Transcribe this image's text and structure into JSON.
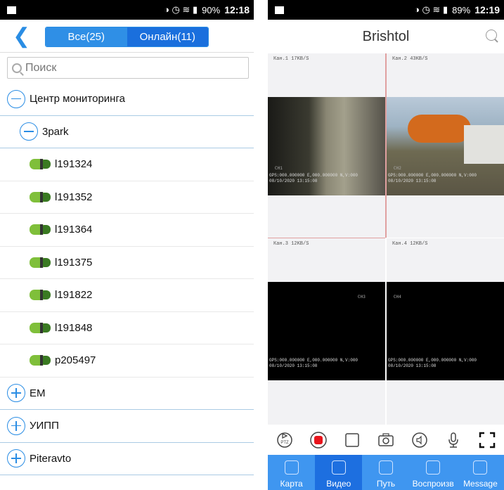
{
  "left": {
    "status": {
      "battery": "90%",
      "time": "12:18"
    },
    "seg_all": "Все(25)",
    "seg_online": "Онлайн(11)",
    "search_placeholder": "Поиск",
    "tree": [
      {
        "type": "group",
        "icon": "minus",
        "label": "Центр мониторинга",
        "indent": 0
      },
      {
        "type": "group",
        "icon": "minus",
        "label": "3park",
        "indent": 1
      },
      {
        "type": "vehicle",
        "label": "l191324"
      },
      {
        "type": "vehicle",
        "label": "l191352"
      },
      {
        "type": "vehicle",
        "label": "l191364"
      },
      {
        "type": "vehicle",
        "label": "l191375"
      },
      {
        "type": "vehicle",
        "label": "l191822"
      },
      {
        "type": "vehicle",
        "label": "l191848"
      },
      {
        "type": "vehicle",
        "label": "p205497"
      },
      {
        "type": "group",
        "icon": "plus",
        "label": "EM",
        "indent": 0
      },
      {
        "type": "group",
        "icon": "plus",
        "label": "УИПП",
        "indent": 0
      },
      {
        "type": "group",
        "icon": "plus",
        "label": "Piteravto",
        "indent": 0
      }
    ]
  },
  "right": {
    "status": {
      "battery": "89%",
      "time": "12:19"
    },
    "title": "Brishtol",
    "cameras": [
      {
        "label": "Кан.1 17KB/S",
        "osd": "GPS:000.000000 E,000.000000 N,V:000\n08/10/2020 13:15:08",
        "ch": "CH1"
      },
      {
        "label": "Кан.2 43KB/S",
        "osd": "GPS:000.000000 E,000.000000 N,V:000\n08/10/2020 13:15:08",
        "ch": "CH2"
      },
      {
        "label": "Кан.3 12KB/S",
        "osd": "GPS:000.000000 E,000.000000 N,V:000\n08/10/2020 13:15:08",
        "ch": "CH3"
      },
      {
        "label": "Кан.4 12KB/S",
        "osd": "GPS:000.000000 E,000.000000 N,V:000\n08/10/2020 13:15:08",
        "ch": "CH4"
      }
    ],
    "ptz_label": "PTZ",
    "nav": [
      {
        "label": "Карта",
        "icon": "map-pin-icon",
        "active": false
      },
      {
        "label": "Видео",
        "icon": "video-icon",
        "active": true
      },
      {
        "label": "Путь",
        "icon": "route-icon",
        "active": false
      },
      {
        "label": "Воспроизв",
        "icon": "playback-icon",
        "active": false
      },
      {
        "label": "Message",
        "icon": "message-icon",
        "active": false
      }
    ]
  },
  "colors": {
    "accent": "#2a8de4",
    "nav_bg": "#3f96f0",
    "nav_active": "#1d6fe0",
    "record": "#e8141c"
  }
}
